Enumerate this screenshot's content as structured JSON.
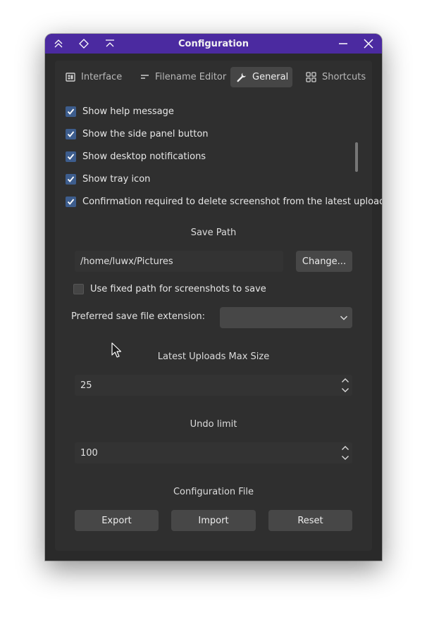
{
  "window": {
    "title": "Configuration",
    "titlebar_buttons": [
      "keep-above-icon",
      "pin-icon",
      "shade-icon",
      "minimize-icon",
      "close-icon"
    ]
  },
  "tabs": [
    {
      "label": "Interface",
      "icon": "interface-icon"
    },
    {
      "label": "Filename Editor",
      "icon": "filename-editor-icon"
    },
    {
      "label": "General",
      "icon": "wrench-icon",
      "active": true
    },
    {
      "label": "Shortcuts",
      "icon": "grid-icon"
    }
  ],
  "checkboxes": [
    {
      "label": "Show help message",
      "checked": true
    },
    {
      "label": "Show the side panel button",
      "checked": true
    },
    {
      "label": "Show desktop notifications",
      "checked": true
    },
    {
      "label": "Show tray icon",
      "checked": true
    },
    {
      "label": "Confirmation required to delete screenshot from the latest uploads",
      "checked": true
    }
  ],
  "save_path": {
    "title": "Save Path",
    "value": "/home/luwx/Pictures",
    "change_label": "Change...",
    "fixed_path_label": "Use fixed path for screenshots to save",
    "fixed_path_checked": false,
    "extension_label": "Preferred save file extension:",
    "extension_value": ""
  },
  "latest_uploads": {
    "title": "Latest Uploads Max Size",
    "value": "25"
  },
  "undo": {
    "title": "Undo limit",
    "value": "100"
  },
  "config_file": {
    "title": "Configuration File",
    "export_label": "Export",
    "import_label": "Import",
    "reset_label": "Reset"
  },
  "colors": {
    "titlebar": "#4b2aa0",
    "checkbox": "#3d5d8d",
    "background": "#2a2a2a"
  }
}
